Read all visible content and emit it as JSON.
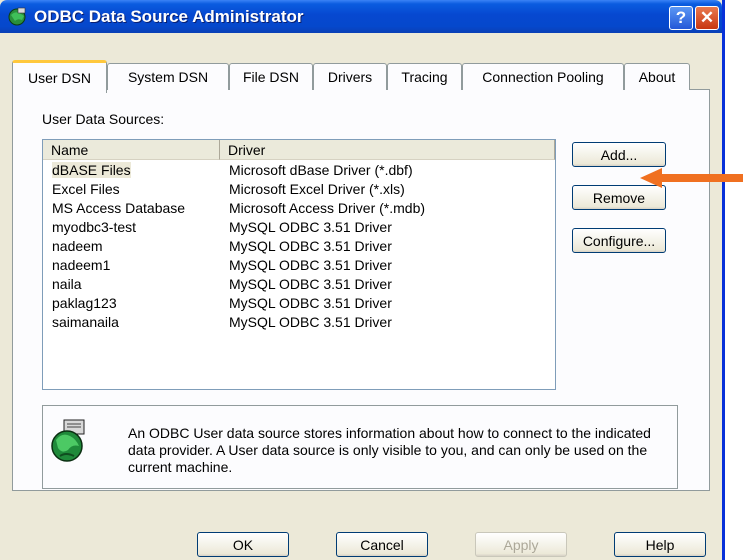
{
  "window": {
    "title": "ODBC Data Source Administrator",
    "help_button": "?",
    "close_button": "✕"
  },
  "tabs": [
    {
      "label": "User DSN",
      "active": true
    },
    {
      "label": "System DSN",
      "active": false
    },
    {
      "label": "File DSN",
      "active": false
    },
    {
      "label": "Drivers",
      "active": false
    },
    {
      "label": "Tracing",
      "active": false
    },
    {
      "label": "Connection Pooling",
      "active": false
    },
    {
      "label": "About",
      "active": false
    }
  ],
  "user_dsn": {
    "section_label": "User Data Sources:",
    "columns": [
      "Name",
      "Driver"
    ],
    "rows": [
      {
        "name": "dBASE Files",
        "driver": "Microsoft dBase Driver (*.dbf)",
        "selected": true
      },
      {
        "name": "Excel Files",
        "driver": "Microsoft Excel Driver (*.xls)",
        "selected": false
      },
      {
        "name": "MS Access Database",
        "driver": "Microsoft Access Driver (*.mdb)",
        "selected": false
      },
      {
        "name": "myodbc3-test",
        "driver": "MySQL ODBC 3.51 Driver",
        "selected": false
      },
      {
        "name": "nadeem",
        "driver": "MySQL ODBC 3.51 Driver",
        "selected": false
      },
      {
        "name": "nadeem1",
        "driver": "MySQL ODBC 3.51 Driver",
        "selected": false
      },
      {
        "name": "naila",
        "driver": "MySQL ODBC 3.51 Driver",
        "selected": false
      },
      {
        "name": "paklag123",
        "driver": "MySQL ODBC 3.51 Driver",
        "selected": false
      },
      {
        "name": "saimanaila",
        "driver": "MySQL ODBC 3.51 Driver",
        "selected": false
      }
    ],
    "buttons": {
      "add": "Add...",
      "remove": "Remove",
      "configure": "Configure..."
    },
    "info_icon": "odbc-globe-icon",
    "info_text": "An ODBC User data source stores information about how to connect to the indicated data provider.  A User data source is only visible to you, and can only be used on the current machine."
  },
  "footer": {
    "ok": "OK",
    "cancel": "Cancel",
    "apply": "Apply",
    "help": "Help"
  },
  "colors": {
    "titlebar": "#0a5ce0",
    "dialog_bg": "#ece9d8",
    "arrow": "#f07020",
    "active_tab_accent": "#ffc83c"
  }
}
